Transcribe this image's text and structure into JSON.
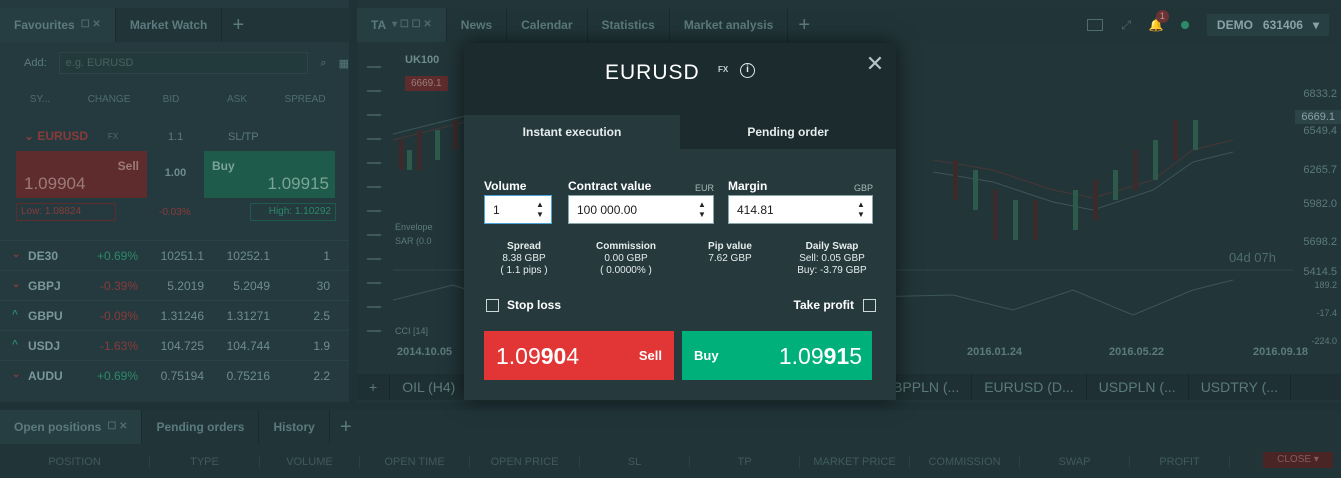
{
  "left_panel": {
    "tabs": [
      {
        "label": "Favourites"
      },
      {
        "label": "Market Watch"
      }
    ],
    "add_label": "Add:",
    "add_placeholder": "e.g. EURUSD",
    "columns": [
      "SY...",
      "CHANGE",
      "BID",
      "ASK",
      "SPREAD"
    ],
    "expanded": {
      "symbol": "EURUSD",
      "tag": "FX",
      "spread": "1.1",
      "sltp": "SL/TP",
      "sell_label": "Sell",
      "sell_price": "1.09904",
      "buy_label": "Buy",
      "buy_price": "1.09915",
      "volume": "1.00",
      "low": "Low: 1.08824",
      "change": "-0.03%",
      "high": "High: 1.10292"
    },
    "rows": [
      {
        "symbol": "DE30",
        "change": "+0.69%",
        "bid": "10251.1",
        "ask": "10252.1",
        "spread": "1"
      },
      {
        "symbol": "GBPJ",
        "change": "-0.39%",
        "bid": "5.2019",
        "ask": "5.2049",
        "spread": "30"
      },
      {
        "symbol": "GBPU",
        "change": "-0.09%",
        "bid": "1.31246",
        "ask": "1.31271",
        "spread": "2.5"
      },
      {
        "symbol": "USDJ",
        "change": "-1.63%",
        "bid": "104.725",
        "ask": "104.744",
        "spread": "1.9"
      },
      {
        "symbol": "AUDU",
        "change": "+0.69%",
        "bid": "0.75194",
        "ask": "0.75216",
        "spread": "2.2"
      }
    ]
  },
  "chart_panel": {
    "tabs": [
      {
        "label": "TA"
      },
      {
        "label": "News"
      },
      {
        "label": "Calendar"
      },
      {
        "label": "Statistics"
      },
      {
        "label": "Market analysis"
      }
    ],
    "symbol": "UK100",
    "price_tag": "6669.1",
    "notifications": "1",
    "account_type": "DEMO",
    "account_id": "631406",
    "y_labels": [
      "6833.2",
      "6549.4",
      "6265.7",
      "5982.0",
      "5698.2",
      "5414.5",
      "189.2",
      "-17.4",
      "-224.0"
    ],
    "y_current": "6669.1",
    "x_labels": [
      "2014.10.05",
      "2016.01.24",
      "2016.05.22",
      "2016.09.18"
    ],
    "countdown": "04d 07h",
    "indicator_env": "Envelope",
    "indicator_sar": "SAR (0.0",
    "indicator_cci": "CCI [14]",
    "bottom_tabs": [
      "OIL (H4)",
      "GBPPLN (...",
      "EURUSD (D...",
      "USDPLN (...",
      "USDTRY (..."
    ]
  },
  "positions": {
    "tabs": [
      {
        "label": "Open positions"
      },
      {
        "label": "Pending orders"
      },
      {
        "label": "History"
      }
    ],
    "columns": [
      "POSITION",
      "TYPE",
      "VOLUME",
      "OPEN TIME",
      "OPEN PRICE",
      "SL",
      "TP",
      "MARKET PRICE",
      "COMMISSION",
      "SWAP",
      "PROFIT"
    ],
    "close_label": "CLOSE"
  },
  "modal": {
    "symbol": "EURUSD",
    "tag": "FX",
    "close_glyph": "✕",
    "info_glyph": "i",
    "tabs": [
      {
        "label": "Instant execution",
        "active": true
      },
      {
        "label": "Pending order",
        "active": false
      }
    ],
    "volume": {
      "label": "Volume",
      "value": "1"
    },
    "contract_value": {
      "label": "Contract value",
      "unit": "EUR",
      "value": "100 000.00"
    },
    "margin": {
      "label": "Margin",
      "unit": "GBP",
      "value": "414.81"
    },
    "spread": {
      "label": "Spread",
      "value": "8.38 GBP",
      "sub": "( 1.1 pips )"
    },
    "commission": {
      "label": "Commission",
      "value": "0.00 GBP",
      "sub": "( 0.0000% )"
    },
    "pip_value": {
      "label": "Pip value",
      "value": "7.62 GBP"
    },
    "daily_swap": {
      "label": "Daily Swap",
      "sell": "Sell: 0.05 GBP",
      "buy": "Buy: -3.79 GBP"
    },
    "stop_loss_label": "Stop loss",
    "take_profit_label": "Take profit",
    "sell": {
      "label": "Sell",
      "price_pre": "1.09",
      "price_big": "90",
      "price_post": "4"
    },
    "buy": {
      "label": "Buy",
      "price_pre": "1.09",
      "price_big": "91",
      "price_post": "5"
    },
    "colors": {
      "sell": "#e23535",
      "buy": "#00b07a",
      "panel": "#263a3e"
    }
  }
}
